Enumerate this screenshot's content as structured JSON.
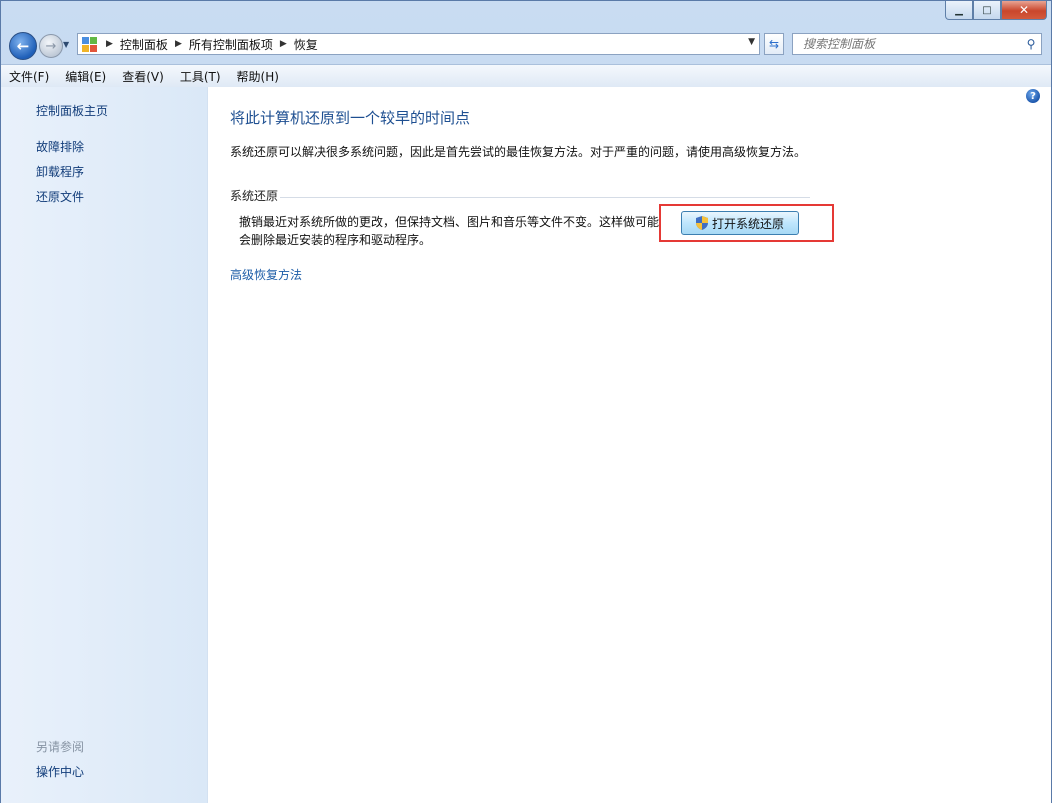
{
  "title_bar": {
    "minimize_glyph": "▁",
    "maximize_glyph": "□",
    "close_glyph": "✕"
  },
  "address_bar": {
    "crumbs": [
      "控制面板",
      "所有控制面板项",
      "恢复"
    ],
    "search_placeholder": "搜索控制面板"
  },
  "menu": [
    "文件(F)",
    "编辑(E)",
    "查看(V)",
    "工具(T)",
    "帮助(H)"
  ],
  "sidebar": {
    "home_link": "控制面板主页",
    "links": [
      "故障排除",
      "卸载程序",
      "还原文件"
    ],
    "see_also_heading": "另请参阅",
    "see_also_links": [
      "操作中心"
    ]
  },
  "main": {
    "title": "将此计算机还原到一个较早的时间点",
    "intro": "系统还原可以解决很多系统问题，因此是首先尝试的最佳恢复方法。对于严重的问题，请使用高级恢复方法。",
    "section_title": "系统还原",
    "description_line1": "撤销最近对系统所做的更改，但保持文档、图片和音乐等文件不变。这样做可能",
    "description_line2": "会删除最近安装的程序和驱动程序。",
    "restore_button": "打开系统还原",
    "advanced_link": "高级恢复方法"
  },
  "colors": {
    "highlight_border": "#e53935",
    "link": "#1e5ea8",
    "title": "#1e4f91"
  }
}
